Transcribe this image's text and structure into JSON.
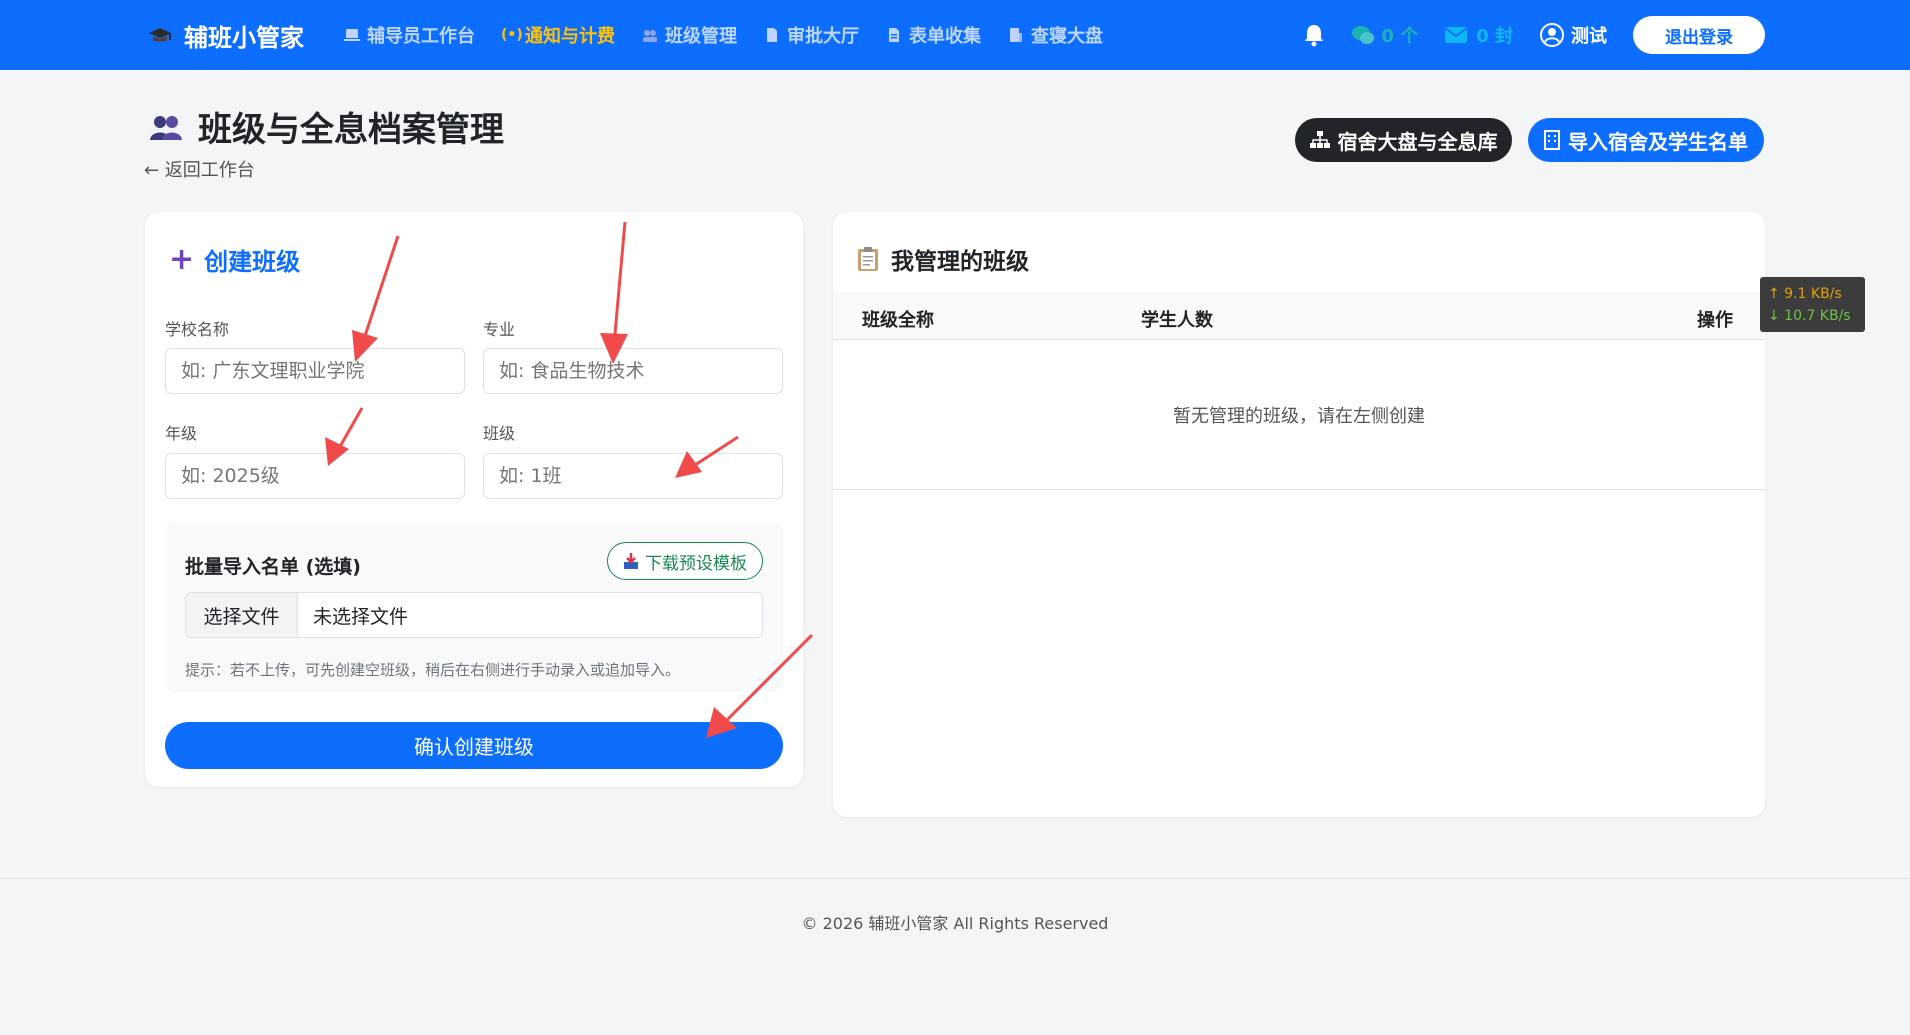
{
  "navbar": {
    "brand": "辅班小管家",
    "items": [
      {
        "label": "辅导员工作台",
        "icon": "laptop-icon",
        "active": false
      },
      {
        "label": "通知与计费",
        "icon": "broadcast-icon",
        "active": true
      },
      {
        "label": "班级管理",
        "icon": "users-icon",
        "active": false
      },
      {
        "label": "审批大厅",
        "icon": "file-icon",
        "active": false
      },
      {
        "label": "表单收集",
        "icon": "form-icon",
        "active": false
      },
      {
        "label": "查寝大盘",
        "icon": "building-icon",
        "active": false
      }
    ],
    "wechat_count": "0 个",
    "mail_count": "0 封",
    "user_name": "测试",
    "logout_label": "退出登录"
  },
  "page": {
    "title": "班级与全息档案管理",
    "back_link": "← 返回工作台",
    "btn_dorm": "宿舍大盘与全息库",
    "btn_import": "导入宿舍及学生名单"
  },
  "create_form": {
    "title": "创建班级",
    "school_label": "学校名称",
    "school_placeholder": "如: 广东文理职业学院",
    "major_label": "专业",
    "major_placeholder": "如: 食品生物技术",
    "grade_label": "年级",
    "grade_placeholder": "如: 2025级",
    "class_label": "班级",
    "class_placeholder": "如: 1班",
    "import_title": "批量导入名单 (选填)",
    "download_label": "下载预设模板",
    "file_button": "选择文件",
    "file_name": "未选择文件",
    "hint": "提示：若不上传，可先创建空班级，稍后在右侧进行手动录入或追加导入。",
    "confirm_label": "确认创建班级"
  },
  "my_classes": {
    "title": "我管理的班级",
    "columns": [
      "班级全称",
      "学生人数",
      "操作"
    ],
    "empty_text": "暂无管理的班级，请在左侧创建"
  },
  "speed_widget": {
    "up": "↑ 9.1 KB/s",
    "down": "↓ 10.7 KB/s"
  },
  "footer": {
    "text": "© 2026 辅班小管家 All Rights Reserved"
  },
  "colors": {
    "primary": "#0d6efd",
    "active_nav": "#ffc107",
    "success": "#198754",
    "annotation_arrow": "#f04a4a"
  }
}
